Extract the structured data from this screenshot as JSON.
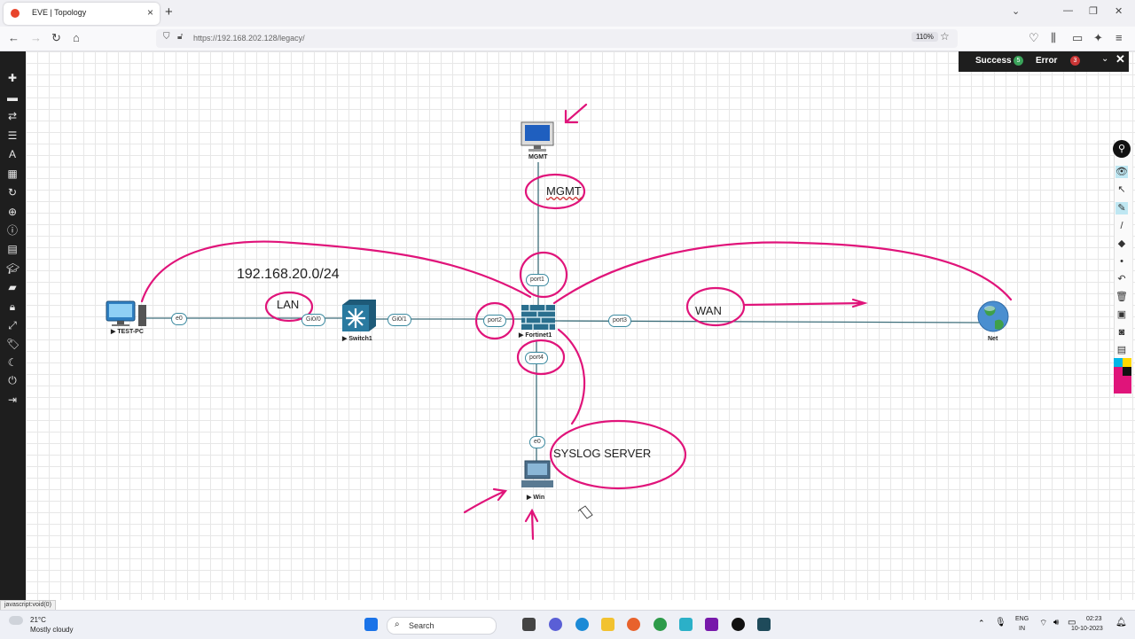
{
  "browser": {
    "tab_title": "EVE | Topology",
    "new_tab": "+",
    "tab_close": "×",
    "url": "https://192.168.202.128/legacy/",
    "zoom": "110%",
    "status_text": "javascript:void(0)"
  },
  "notifications": {
    "success_label": "Success",
    "success_count": "5",
    "error_label": "Error",
    "error_count": "3"
  },
  "sidebar": {
    "items": [
      "add-node",
      "add-network",
      "connections",
      "nodes-list",
      "text",
      "status",
      "reload",
      "zoom",
      "info",
      "lab-details",
      "education",
      "chat",
      "lock",
      "fullscreen",
      "tags",
      "dark-mode",
      "power",
      "logout"
    ]
  },
  "topology": {
    "nodes": {
      "mgmt": "MGMT",
      "test_pc": "TEST-PC",
      "switch1": "Switch1",
      "fortinet1": "Fortinet1",
      "net": "Net",
      "win": "Win"
    },
    "ports": {
      "e0_testpc": "e0",
      "gi00": "Gi0/0",
      "gi01": "Gi0/1",
      "port1": "port1",
      "port2": "port2",
      "port3": "port3",
      "port4": "port4",
      "e0_win": "e0"
    },
    "annotations": {
      "subnet": "192.168.20.0/24",
      "lan": "LAN",
      "wan": "WAN",
      "mgmt": "MGMT",
      "syslog": "SYSLOG SERVER"
    },
    "ink_color": "#e0147a",
    "link_color": "#3d6e7a"
  },
  "taskbar": {
    "weather_temp": "21°C",
    "weather_desc": "Mostly cloudy",
    "search_label": "Search",
    "lang_line1": "ENG",
    "lang_line2": "IN",
    "time": "02:23",
    "date": "10-10-2023"
  }
}
